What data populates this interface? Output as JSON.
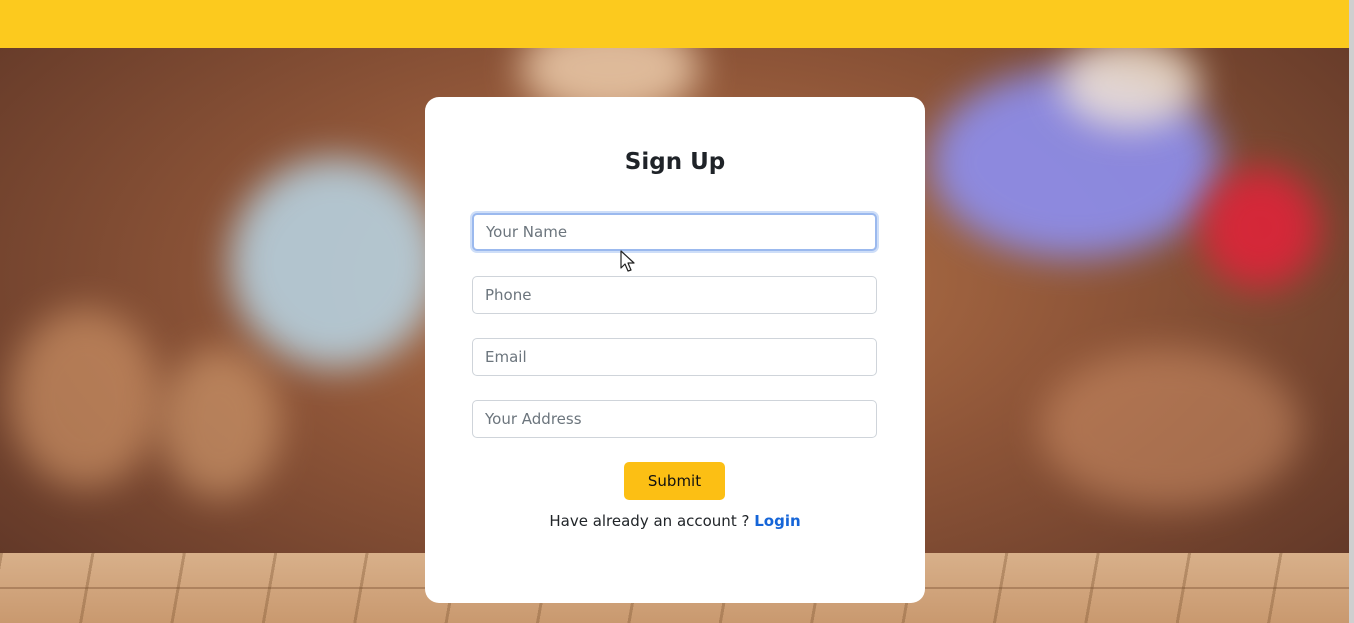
{
  "form": {
    "title": "Sign Up",
    "fields": {
      "name": {
        "placeholder": "Your Name",
        "value": ""
      },
      "phone": {
        "placeholder": "Phone",
        "value": ""
      },
      "email": {
        "placeholder": "Email",
        "value": ""
      },
      "address": {
        "placeholder": "Your Address",
        "value": ""
      }
    },
    "submit_label": "Submit",
    "login_prompt": "Have already an account ?",
    "login_link": "Login"
  },
  "colors": {
    "header": "#fcca1e",
    "submit": "#fcbf14",
    "link": "#1565d8",
    "focus": "#9bb9ee"
  }
}
